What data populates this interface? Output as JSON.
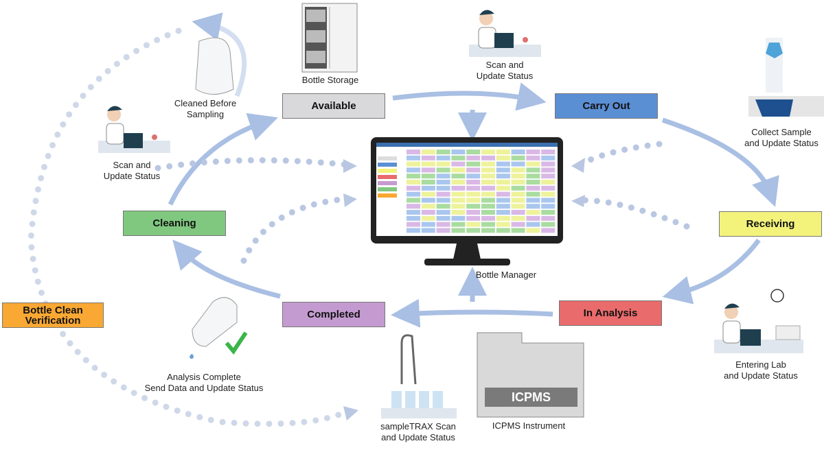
{
  "stages": {
    "available": {
      "label": "Available",
      "color": "#d9d9db"
    },
    "carry_out": {
      "label": "Carry Out",
      "color": "#5b8fd4"
    },
    "receiving": {
      "label": "Receiving",
      "color": "#f3f37c"
    },
    "in_analysis": {
      "label": "In Analysis",
      "color": "#e96b6b"
    },
    "completed": {
      "label": "Completed",
      "color": "#c49bd0"
    },
    "cleaning": {
      "label": "Cleaning",
      "color": "#80c880"
    },
    "bottle_clean_verification": {
      "label": "Bottle Clean\nVerification",
      "line1": "Bottle Clean",
      "line2": "Verification",
      "color": "#f9a833"
    }
  },
  "captions": {
    "bottle_storage": "Bottle Storage",
    "scan_top_1": "Scan and",
    "scan_top_2": "Update Status",
    "collect_1": "Collect Sample",
    "collect_2": "and Update Status",
    "cleaned_1": "Cleaned Before",
    "cleaned_2": "Sampling",
    "scan_left_1": "Scan and",
    "scan_left_2": "Update Status",
    "bottle_manager": "Bottle Manager",
    "entering_1": "Entering Lab",
    "entering_2": "and Update Status",
    "analysis_1": "Analysis Complete",
    "analysis_2": "Send Data and Update Status",
    "sampletrax_1": "sampleTRAX Scan",
    "sampletrax_2": "and Update Status",
    "icpms_instrument": "ICPMS Instrument",
    "icpms_label": "ICPMS"
  },
  "colors": {
    "arrow": "#a9bfe3",
    "dots": "#c9d3e6",
    "check": "#3bb54a"
  }
}
